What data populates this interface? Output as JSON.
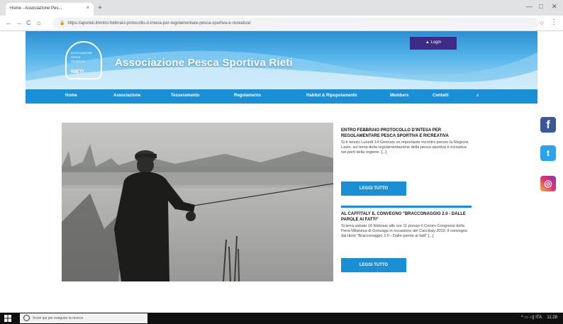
{
  "browser": {
    "tab_title": "Home - Associazione Pes...",
    "tab_close": "×",
    "new_tab": "+",
    "url": "https://apsrieti.it/entro-febbraio-protocollo-d-intesa-per-regolamentare-pesca-sportiva-e-ricreativa/",
    "window_min": "—",
    "window_max": "□",
    "window_close": "✕",
    "back": "←",
    "forward": "→",
    "reload": "C",
    "home": "⌂",
    "lock": "🔒",
    "star": "☆",
    "menu": "⋮"
  },
  "site": {
    "logo_line1": "ASSOCIAZIONE",
    "logo_line2": "PESCA",
    "logo_line3": "SPORTIVA",
    "logo_big": "RIETI",
    "title": "Associazione Pesca Sportiva Rieti",
    "login_label": "Login",
    "nav": [
      "Home",
      "Associazione",
      "Tesseramento",
      "Regolamento",
      "Habitat & Ripopolamento",
      "Members",
      "Contatti"
    ],
    "search_icon": "⌕"
  },
  "articles": [
    {
      "title": "Entro febbraio protocollo d'intesa per regolamentare pesca sportiva e ricreativa",
      "text": "Si è tenuto Lunedì 14 Gennaio un importante incontro presso la Regione Lazio, sul tema della regolamentazione della pesca sportiva e ricreativa nei porti della regione. [...]",
      "button": "LEGGI TUTTO"
    },
    {
      "title": "Al Caffitaly il convegno \"Bracconaggio 2.0 - Dalle parole ai fatti\"",
      "text": "Si terrà sabato 16 febbraio alle ore 11 presso il Centro Congressi della Fiera Milanesa di Gonzaga in occasione del Caccitaly 2019, il convegno dal titolo \"Bracconaggio 2.0 - Dalle parole ai fatti\" [...]",
      "button": "LEGGI TUTTO"
    }
  ],
  "social": {
    "facebook": "f",
    "twitter": "t",
    "instagram": "◎"
  },
  "taskbar": {
    "search_placeholder": "Scrivi qui per eseguire la ricerca",
    "clock": "11:28",
    "tray_icons": "^ ▭ ◁) ITA"
  },
  "colors": {
    "brand_blue": "#1b8fd6",
    "login_purple": "#3d2b86"
  }
}
